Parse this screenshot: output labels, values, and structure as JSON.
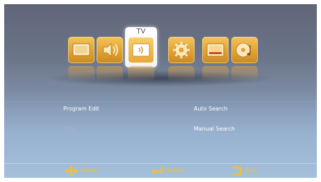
{
  "main_menu": {
    "selected_label": "TV",
    "icons": [
      "picture-icon",
      "sound-icon",
      "tv-icon",
      "setup-icon",
      "time-icon",
      "media-icon"
    ]
  },
  "submenu": {
    "left": [
      {
        "label": "Program Edit",
        "enabled": true
      },
      {
        "label": "EPG",
        "enabled": false
      }
    ],
    "right": [
      {
        "label": "Auto Search",
        "enabled": true
      },
      {
        "label": "Manual Search",
        "enabled": true
      }
    ]
  },
  "hints": {
    "move": "Move",
    "select": "Select",
    "exit": "Exit"
  },
  "colors": {
    "accent": "#f2c030",
    "tile": "#e2a132",
    "text": "#ffffff",
    "disabled_text": "#aab4c4"
  }
}
